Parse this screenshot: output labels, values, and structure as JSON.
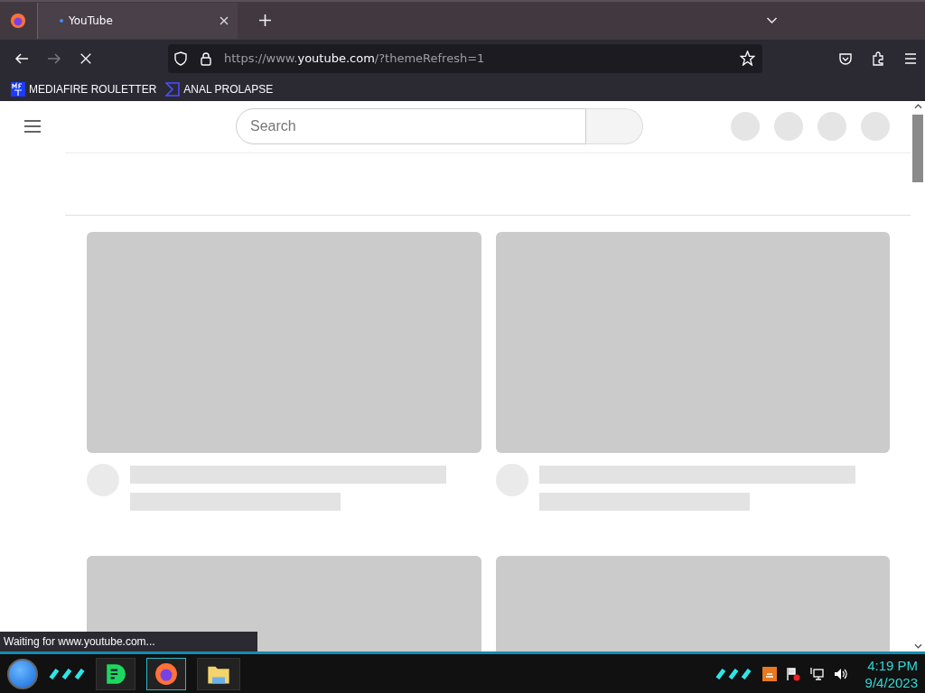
{
  "browser": {
    "tabs": [
      {
        "title": "YouTube",
        "loading": true,
        "selected": true
      }
    ],
    "address": "https://www.**youtube.com**/?themeRefresh=1",
    "bookmarks": [
      {
        "label": "MEDIAFIRE ROULETTER",
        "kind": "mft"
      },
      {
        "label": "ANAL PROLAPSE",
        "kind": "sigma"
      }
    ],
    "status_bar": "Waiting for www.youtube.com..."
  },
  "page": {
    "search": {
      "placeholder": "Search"
    }
  },
  "taskbar": {
    "time": "4:19 PM",
    "date": "9/4/2023"
  }
}
